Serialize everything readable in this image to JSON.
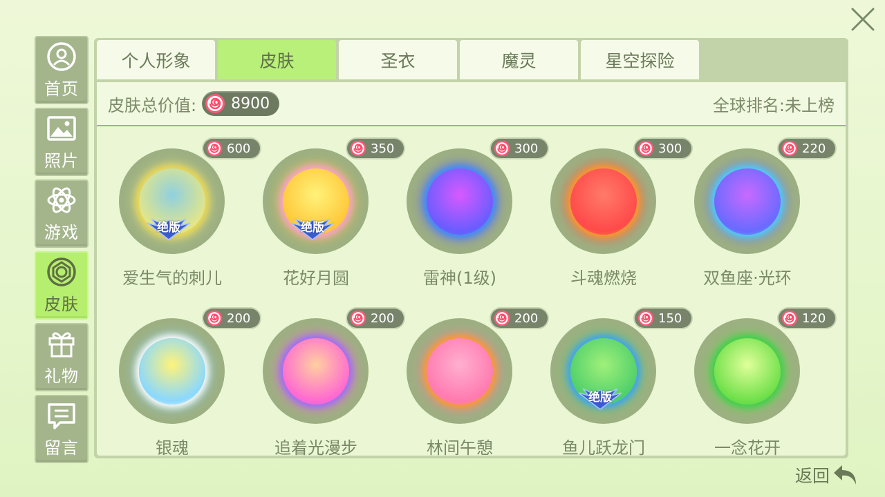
{
  "close_icon": "close-x-icon",
  "sidebar": {
    "items": [
      {
        "label": "首页",
        "icon": "user-icon",
        "active": false
      },
      {
        "label": "照片",
        "icon": "photo-icon",
        "active": false
      },
      {
        "label": "游戏",
        "icon": "atom-icon",
        "active": false
      },
      {
        "label": "皮肤",
        "icon": "skin-icon",
        "active": true
      },
      {
        "label": "礼物",
        "icon": "gift-icon",
        "active": false
      },
      {
        "label": "留言",
        "icon": "message-icon",
        "active": false
      }
    ]
  },
  "tabs": [
    {
      "label": "个人形象",
      "active": false
    },
    {
      "label": "皮肤",
      "active": true
    },
    {
      "label": "圣衣",
      "active": false
    },
    {
      "label": "魔灵",
      "active": false
    },
    {
      "label": "星空探险",
      "active": false
    }
  ],
  "info": {
    "total_label": "皮肤总价值:",
    "total_value": "8900",
    "rank_text": "全球排名:未上榜"
  },
  "skins": [
    {
      "name": "爱生气的刺儿",
      "price": "600",
      "badge": "绝版",
      "colors": [
        "#8fd0e0",
        "#e2e68a",
        "#f0d850"
      ]
    },
    {
      "name": "花好月圆",
      "price": "350",
      "badge": "绝版",
      "colors": [
        "#fff27a",
        "#ffc83a",
        "#ff9fd0"
      ]
    },
    {
      "name": "雷神(1级)",
      "price": "300",
      "badge": "",
      "colors": [
        "#d85aff",
        "#6a5cff",
        "#3a8cff"
      ]
    },
    {
      "name": "斗魂燃烧",
      "price": "300",
      "badge": "",
      "colors": [
        "#ff7a6a",
        "#ff4a4a",
        "#ff9a2a"
      ]
    },
    {
      "name": "双鱼座·光环",
      "price": "220",
      "badge": "",
      "colors": [
        "#c86aff",
        "#6a6aff",
        "#4ad0ff"
      ]
    },
    {
      "name": "银魂",
      "price": "200",
      "badge": "",
      "colors": [
        "#fff37a",
        "#8ad8ff",
        "#ffffff"
      ]
    },
    {
      "name": "追着光漫步",
      "price": "200",
      "badge": "",
      "colors": [
        "#ffd0a0",
        "#ff6ad0",
        "#9a6aff"
      ]
    },
    {
      "name": "林间午憩",
      "price": "200",
      "badge": "",
      "colors": [
        "#ffb0d0",
        "#ff7ab0",
        "#ff9a2a"
      ]
    },
    {
      "name": "鱼儿跃龙门",
      "price": "150",
      "badge": "绝版",
      "colors": [
        "#a0f07a",
        "#50d06a",
        "#3aa0ff"
      ]
    },
    {
      "name": "一念花开",
      "price": "120",
      "badge": "",
      "colors": [
        "#e0ff9a",
        "#70e04a",
        "#3ad04a"
      ]
    }
  ],
  "back": {
    "label": "返回",
    "icon": "back-arrow-icon"
  }
}
